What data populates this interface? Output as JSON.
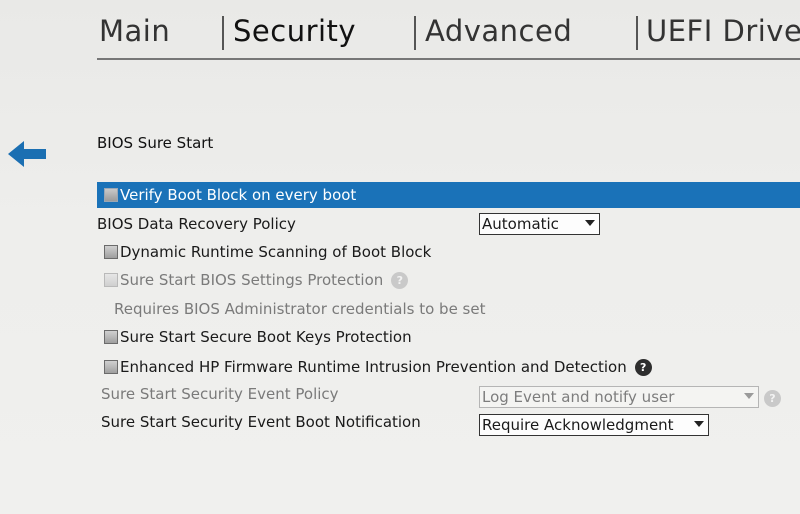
{
  "tabs": [
    {
      "label": "Main"
    },
    {
      "label": "Security",
      "active": true
    },
    {
      "label": "Advanced"
    },
    {
      "label": "UEFI Drive"
    }
  ],
  "section": {
    "title": "BIOS Sure Start"
  },
  "settings": {
    "verify_boot_block": {
      "label": "Verify Boot Block on every boot",
      "checked": false
    },
    "data_recovery_policy": {
      "label": "BIOS Data Recovery Policy",
      "value": "Automatic"
    },
    "dynamic_runtime_scanning": {
      "label": "Dynamic Runtime Scanning of Boot Block",
      "checked": false
    },
    "settings_protection": {
      "label": "Sure Start BIOS Settings Protection",
      "checked": false,
      "enabled": false,
      "note": "Requires BIOS Administrator credentials to be set"
    },
    "secure_boot_keys": {
      "label": "Sure Start Secure Boot Keys Protection",
      "checked": false
    },
    "enhanced_intrusion": {
      "label": "Enhanced HP Firmware Runtime Intrusion Prevention and Detection",
      "checked": false
    },
    "security_event_policy": {
      "label": "Sure Start Security Event Policy",
      "value": "Log Event and notify user",
      "enabled": false
    },
    "boot_notification": {
      "label": "Sure Start Security Event Boot Notification",
      "value": "Require Acknowledgment"
    }
  },
  "help_glyph": "?",
  "icons": {
    "back": "arrow-left-icon",
    "help": "help-icon",
    "checkbox": "checkbox"
  },
  "colors": {
    "selection": "#1a72b8",
    "help_icon": "#2e2e2e"
  }
}
